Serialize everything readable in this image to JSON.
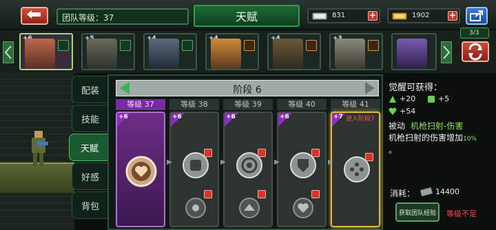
{
  "header": {
    "team_level_label": "团队等级：37",
    "title": "天赋",
    "resource_1": "831",
    "resource_2": "1902"
  },
  "heroes": [
    {
      "stars": "+6"
    },
    {
      "stars": "+5"
    },
    {
      "stars": "+4"
    },
    {
      "stars": "+4"
    },
    {
      "stars": "+4"
    },
    {
      "stars": "+3"
    },
    {
      "stars": ""
    }
  ],
  "team_count": "3/3",
  "tabs": [
    "配装",
    "技能",
    "天赋",
    "好感",
    "背包"
  ],
  "active_tab": "天赋",
  "stage": {
    "label": "阶段 6",
    "columns": [
      {
        "level": "等级 37",
        "badge": "+6"
      },
      {
        "level": "等级 38",
        "badge": "+6"
      },
      {
        "level": "等级 39",
        "badge": "+6"
      },
      {
        "level": "等级 40",
        "badge": "+6"
      },
      {
        "level": "等级 41",
        "badge": "+7",
        "tip": "进入阶段7"
      }
    ]
  },
  "info": {
    "heading": "觉醒可获得：",
    "stat_1": "+20",
    "stat_2": "+5",
    "stat_3": "+54",
    "skill_type": "被动",
    "skill_name": "机枪扫射-伤害",
    "desc_prefix": "机枪扫射的伤害增加",
    "desc_pct": "10%",
    "desc_suffix": "。",
    "cost_label": "消耗：",
    "cost_value": "14400",
    "exp_button": "获取团队经验",
    "insufficient": "等级不足"
  },
  "colors": {
    "accent_green": "#8fe05a",
    "warning_red": "#ff4b3f",
    "active_purple": "#7a2aa5",
    "next_gold": "#e0b742"
  }
}
